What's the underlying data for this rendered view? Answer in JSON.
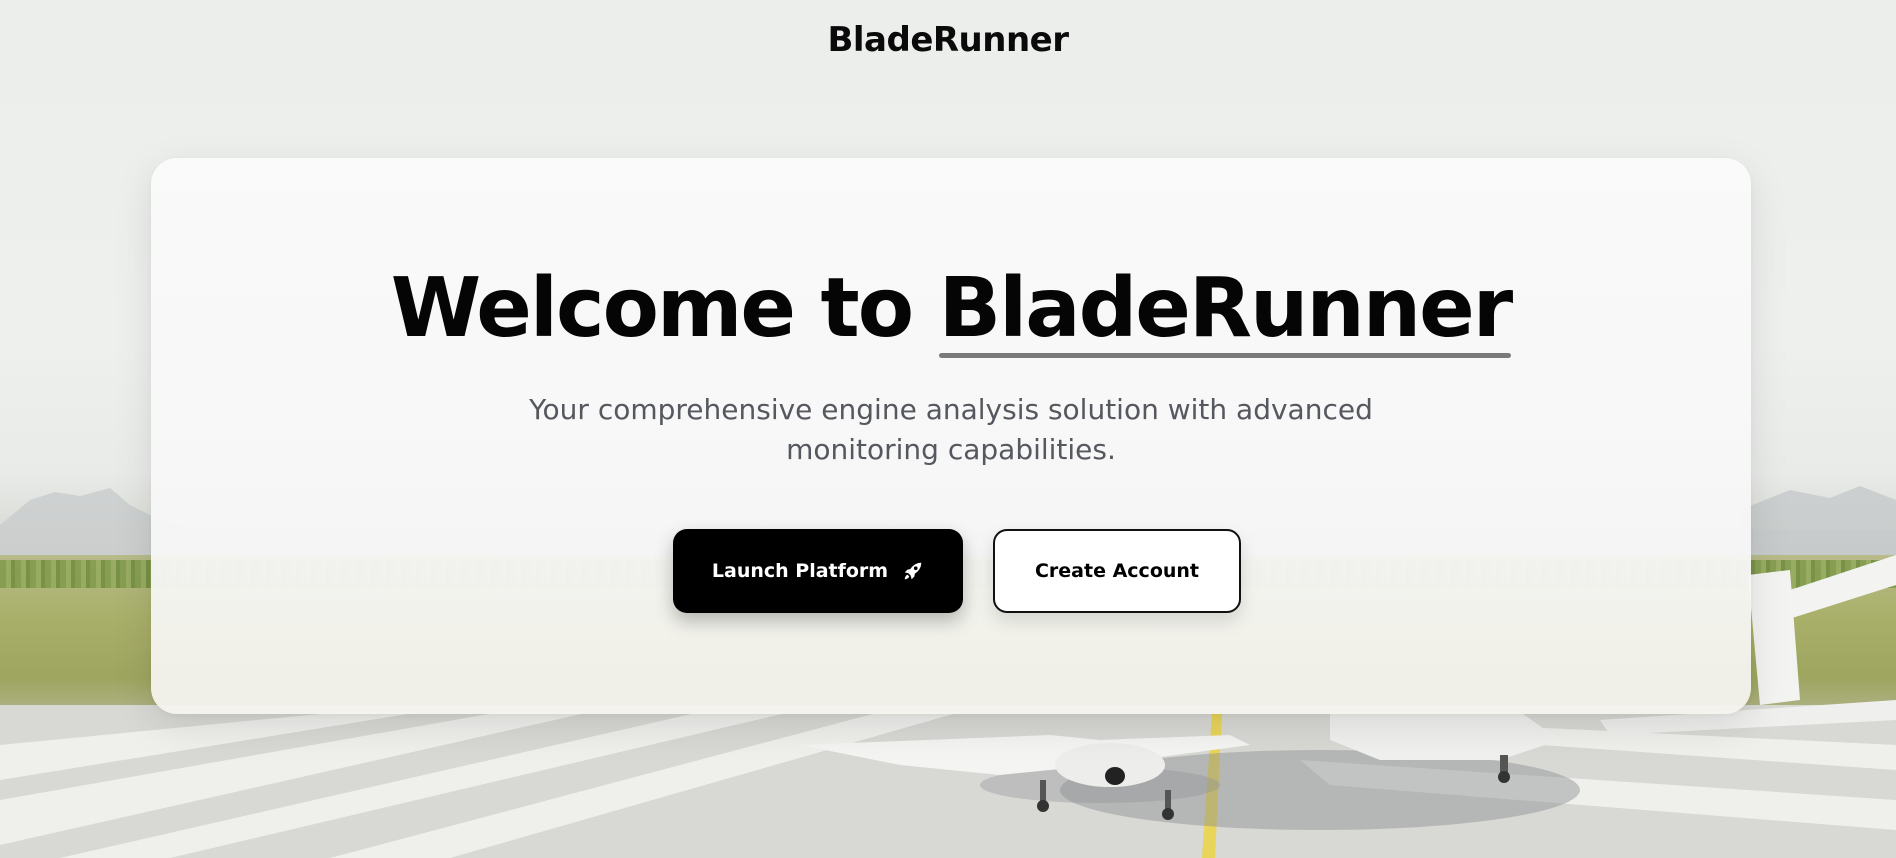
{
  "header": {
    "brand": "BladeRunner"
  },
  "hero": {
    "title_prefix": "Welcome to ",
    "title_brand": "BladeRunner",
    "subtitle": "Your comprehensive engine analysis solution with advanced monitoring capabilities."
  },
  "actions": {
    "launch_label": "Launch Platform",
    "launch_icon": "rocket-icon",
    "create_label": "Create Account"
  },
  "colors": {
    "primary_button": "#000000",
    "secondary_button": "#ffffff",
    "underline": "#7a7a7a"
  }
}
